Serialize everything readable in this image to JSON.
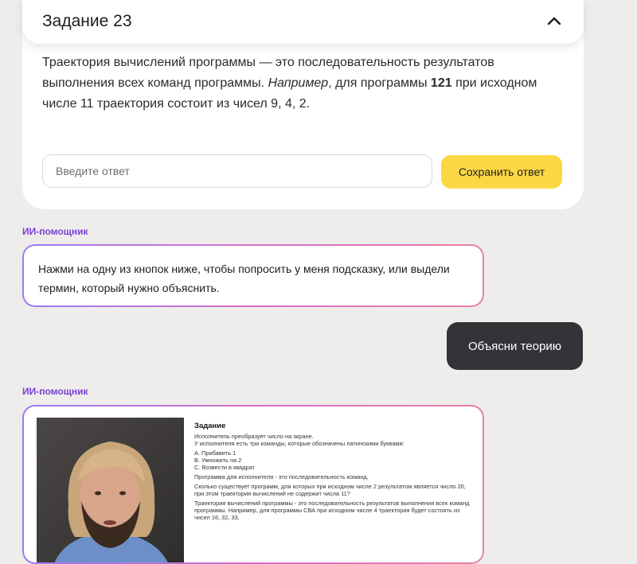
{
  "task": {
    "title": "Задание 23",
    "text_part1": "Траектория вычислений программы — это последовательность результатов выполнения всех команд программы. ",
    "text_italic": "Например",
    "text_part2": ", для программы ",
    "text_bold": "121",
    "text_part3": " при исходном числе 11 траектория состоит из чисел 9, 4, 2.",
    "input_placeholder": "Введите ответ",
    "input_value": "",
    "save_label": "Сохранить ответ"
  },
  "chat": {
    "assistant_label_1": "ИИ-помощник",
    "assistant_message_1": "Нажми на одну из кнопок ниже, чтобы попросить у меня подсказку, или выдели термин, который нужно объяснить.",
    "user_message": "Объясни теорию",
    "assistant_label_2": "ИИ-помощник"
  },
  "video_slide": {
    "title": "Задание",
    "lines": [
      "Исполнитель преобразует число на экране.",
      "У исполнителя есть три команды, которые обозначены латинскими буквами:",
      "А. Прибавить 1",
      "В. Умножить на 2",
      "С. Возвести в квадрат",
      "Программа для исполнителя - это последовательность команд.",
      "Сколько существует программ, для которых при исходном числе 2 результатом является число 20, при этом траектория вычислений не содержит числа 11?",
      "Траектория вычислений программы - это последовательность результатов выполнения всех команд программы. Например, для программы СВА при исходном числе 4 траектория будет состоять из чисел 16, 32, 33."
    ]
  },
  "colors": {
    "accent_purple": "#7a3fd6",
    "save_button": "#fcd744",
    "user_bubble": "#333438",
    "page_bg": "#eeedec"
  },
  "icons": {
    "collapse": "chevron-up-icon"
  }
}
